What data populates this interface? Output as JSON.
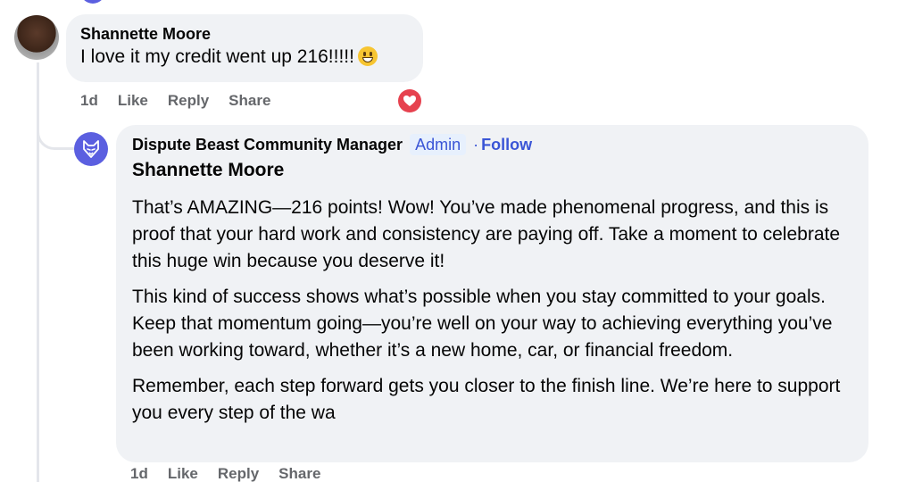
{
  "comment": {
    "author": "Shannette Moore",
    "text": "I love it my credit went up 216!!!!!",
    "emoji": "grinning-face-emoji",
    "time": "1d",
    "actions": {
      "like": "Like",
      "reply": "Reply",
      "share": "Share"
    },
    "reaction": "heart-icon"
  },
  "reply": {
    "author": "Dispute Beast Community Manager",
    "badge": "Admin",
    "separator": "·",
    "follow": "Follow",
    "mention": "Shannette Moore",
    "paragraphs": [
      "That’s AMAZING—216 points! Wow! You’ve made phenomenal progress, and this is proof that your hard work and consistency are paying off. Take a moment to celebrate this huge win because you deserve it!",
      "This kind of success shows what’s possible when you stay committed to your goals. Keep that momentum going—you’re well on your way to achieving everything you’ve been working toward, whether it’s a new home, car, or financial freedom.",
      "Remember, each step forward gets you closer to the finish line. We’re here to support you every step of the wa"
    ],
    "time": "1d",
    "actions": {
      "like": "Like",
      "reply": "Reply",
      "share": "Share"
    }
  },
  "colors": {
    "accent": "#5b5fe0",
    "link": "#3a55d6",
    "bubble": "#f0f2f5",
    "meta": "#65676b",
    "heart": "#e6424f"
  }
}
